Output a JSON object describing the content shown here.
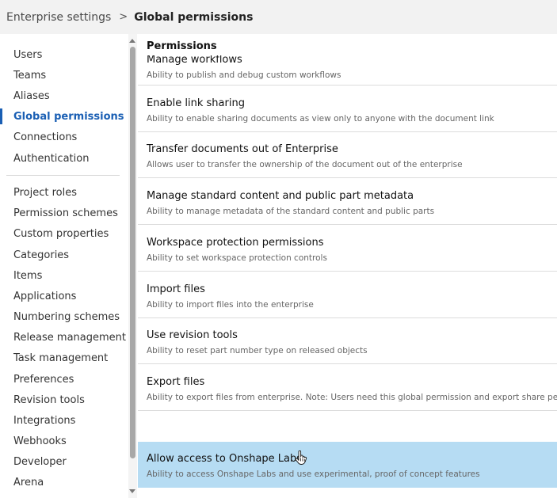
{
  "breadcrumb": {
    "parent": "Enterprise settings",
    "separator": ">",
    "current": "Global permissions"
  },
  "sidebar": {
    "group1": [
      {
        "label": "Users"
      },
      {
        "label": "Teams"
      },
      {
        "label": "Aliases"
      },
      {
        "label": "Global permissions",
        "active": true
      },
      {
        "label": "Connections"
      },
      {
        "label": "Authentication"
      }
    ],
    "group2": [
      {
        "label": "Project roles"
      },
      {
        "label": "Permission schemes"
      },
      {
        "label": "Custom properties"
      },
      {
        "label": "Categories"
      },
      {
        "label": "Items"
      },
      {
        "label": "Applications"
      },
      {
        "label": "Numbering schemes"
      },
      {
        "label": "Release management"
      },
      {
        "label": "Task management"
      },
      {
        "label": "Preferences"
      },
      {
        "label": "Revision tools"
      },
      {
        "label": "Integrations"
      },
      {
        "label": "Webhooks"
      },
      {
        "label": "Developer"
      },
      {
        "label": "Arena"
      }
    ]
  },
  "main": {
    "section_title": "Permissions",
    "permissions": [
      {
        "title": "Manage workflows",
        "description": "Ability to publish and debug custom workflows"
      },
      {
        "title": "Enable link sharing",
        "description": "Ability to enable sharing documents as view only to anyone with the document link"
      },
      {
        "title": "Transfer documents out of Enterprise",
        "description": "Allows user to transfer the ownership of the document out of the enterprise"
      },
      {
        "title": "Manage standard content and public part metadata",
        "description": "Ability to manage metadata of the standard content and public parts"
      },
      {
        "title": "Workspace protection permissions",
        "description": "Ability to set workspace protection controls"
      },
      {
        "title": "Import files",
        "description": "Ability to import files into the enterprise"
      },
      {
        "title": "Use revision tools",
        "description": "Ability to reset part number type on released objects"
      },
      {
        "title": "Export files",
        "description": "Ability to export files from enterprise. Note: Users need this global permission and export share permission"
      },
      {
        "title": "Allow access to Onshape Labs",
        "description": "Ability to access Onshape Labs and use experimental, proof of concept features",
        "highlighted": true
      }
    ]
  },
  "colors": {
    "accent": "#1a5fb4",
    "highlight_row": "#b6dcf3",
    "topbar_bg": "#f2f2f2"
  },
  "icons": {
    "cursor": "hand-pointer-icon",
    "scroll_up": "scroll-up-arrow-icon",
    "scroll_down": "scroll-down-arrow-icon"
  }
}
